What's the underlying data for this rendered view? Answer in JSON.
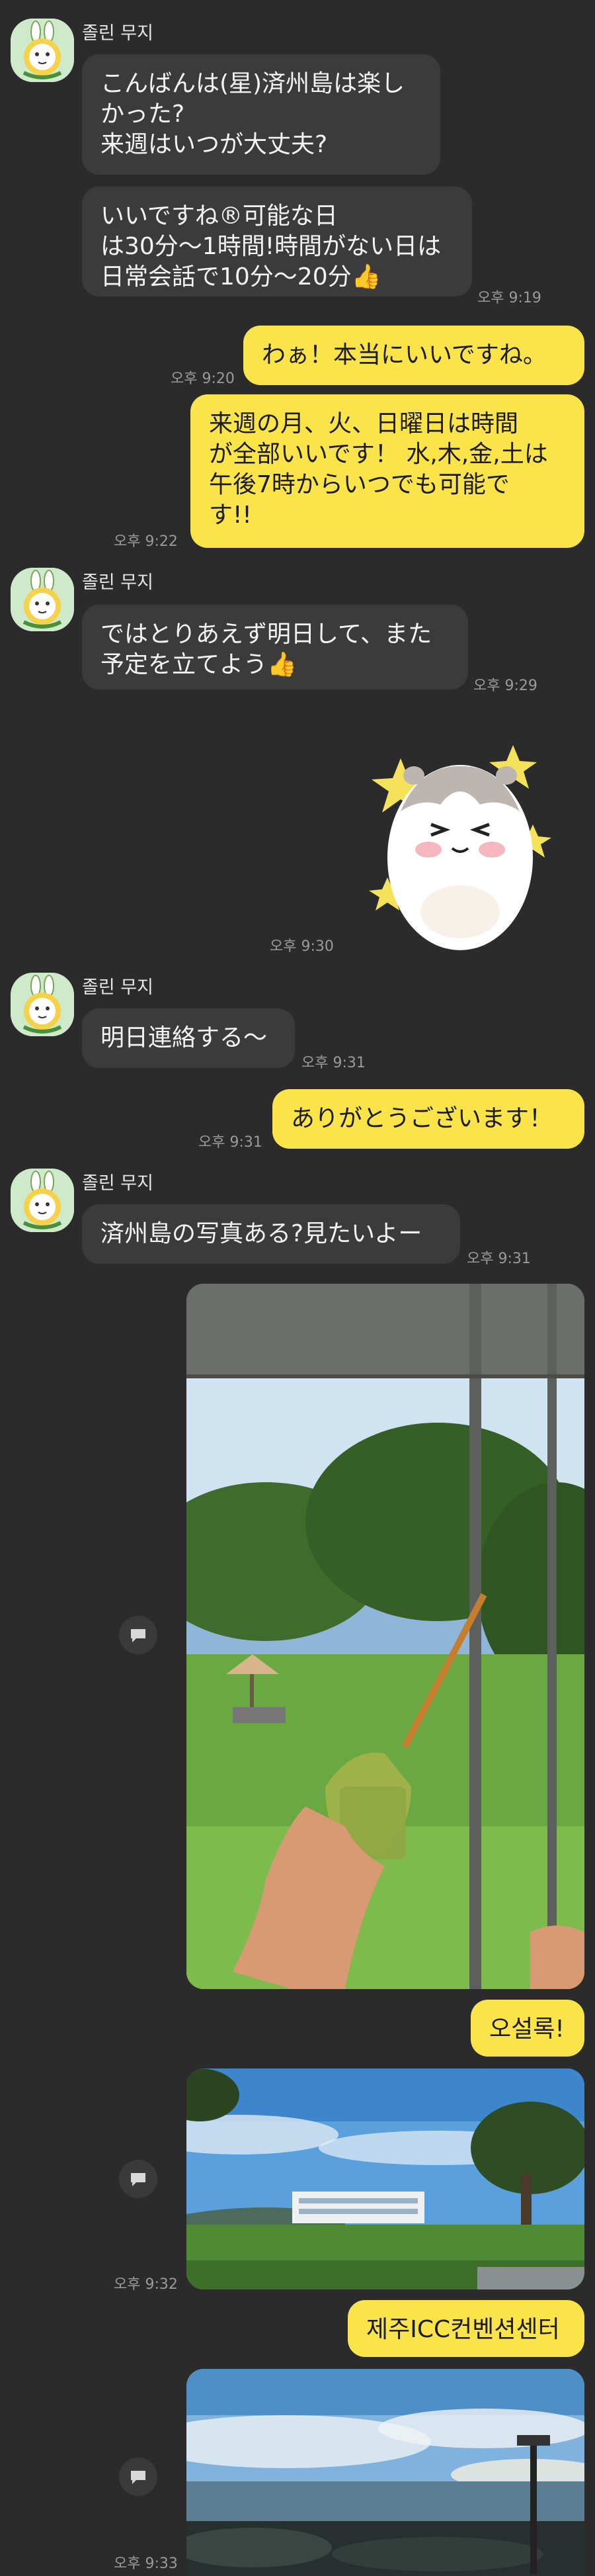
{
  "chat": {
    "sender_name": "졸린 무지",
    "messages": [
      {
        "text": "こんばんは(星)済州島は楽し\nかった?\n来週はいつが大丈夫?"
      },
      {
        "text": "いいですね®可能な日\nは30分〜1時間!時間がない日は\n日常会話で10分〜20分👍",
        "time": "오후 9:19"
      },
      {
        "text": "わぁ！本当にいいですね。",
        "time": "오후 9:20"
      },
      {
        "text": "来週の月、火、日曜日は時間\nが全部いいです！ 水,木,金,土は\n午後7時からいつでも可能で\nす!!",
        "time": "오후 9:22"
      },
      {
        "text": "ではとりあえず明日して、また\n予定を立てよう👍",
        "time": "오후 9:29"
      },
      {
        "sticker": "hamster-sticker",
        "time": "오후 9:30"
      },
      {
        "text": "明日連絡する〜",
        "time": "오후 9:31"
      },
      {
        "text": "ありがとうございます！",
        "time": "오후 9:31"
      },
      {
        "text": "済州島の写真ある?見たいよー",
        "time": "오후 9:31"
      },
      {
        "text": "오설록!"
      },
      {
        "time": "오후 9:32"
      },
      {
        "text": "제주ICC컨벤션센터"
      },
      {
        "time": "오후 9:33"
      }
    ]
  },
  "colors": {
    "background": "#2b2b2b",
    "incoming_bubble": "#3b3b3b",
    "outgoing_bubble": "#fae44a"
  },
  "icons": {
    "share": "speech-bubble-icon"
  }
}
